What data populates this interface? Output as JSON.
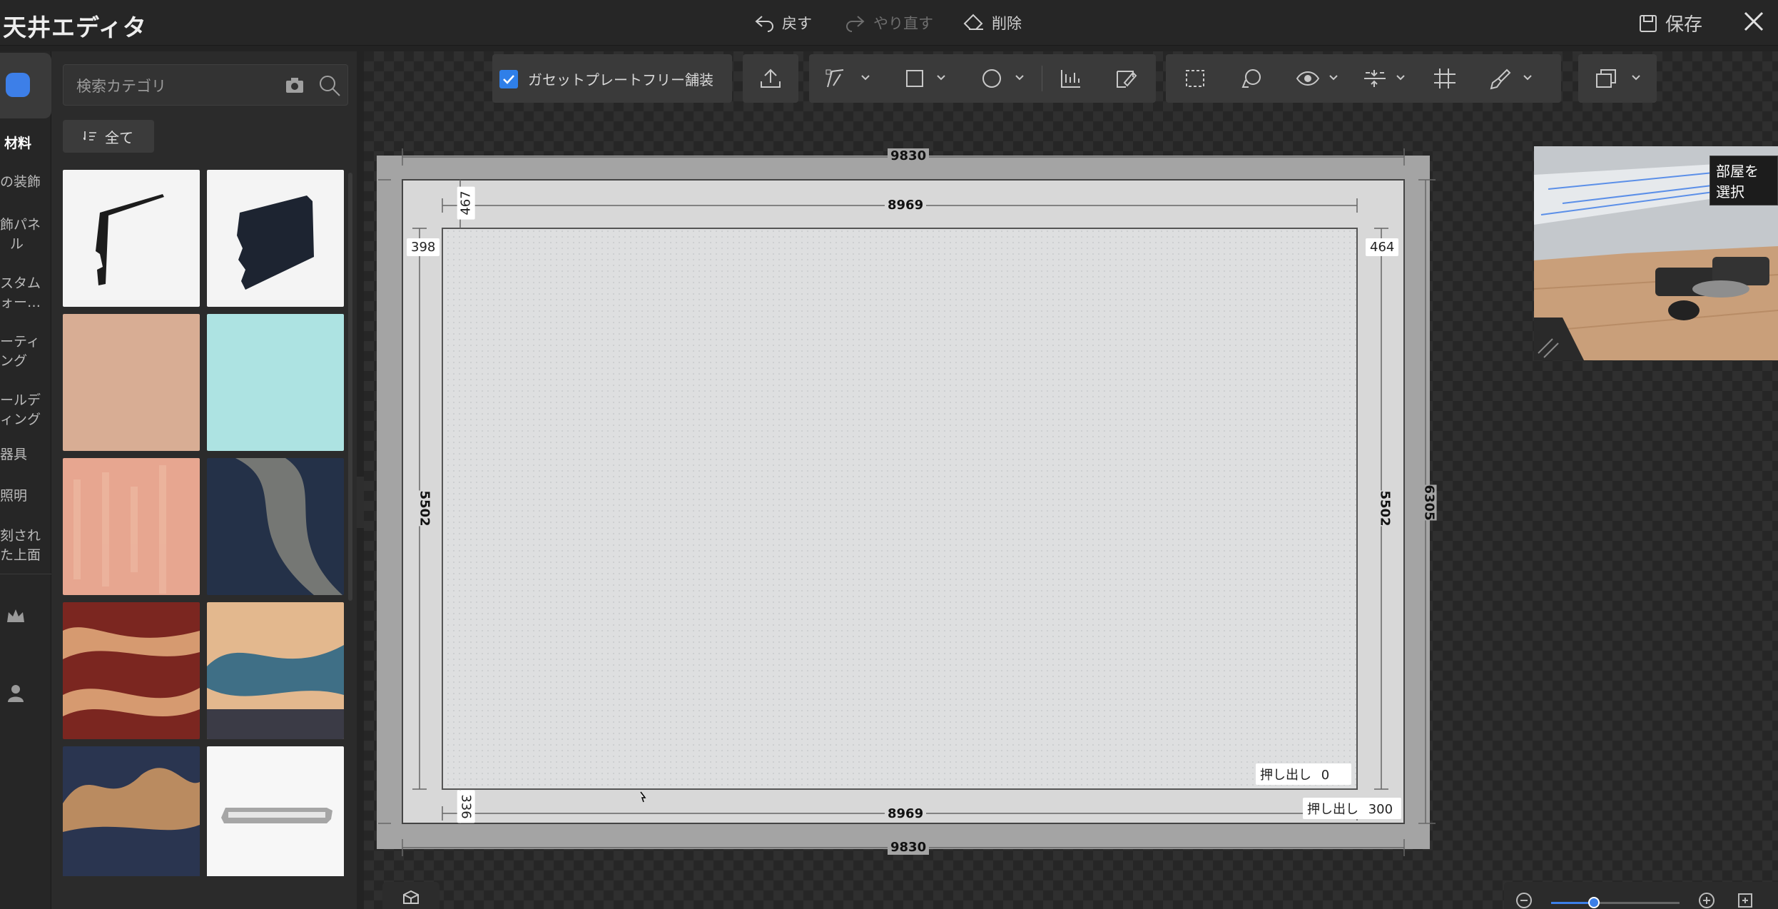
{
  "app": {
    "title": "天井エディタ"
  },
  "topbar": {
    "undo_label": "戻す",
    "redo_label": "やり直す",
    "delete_label": "削除",
    "save_label": "保存"
  },
  "rail": {
    "items": [
      {
        "label": "材料",
        "active": true
      },
      {
        "label": "の装飾"
      },
      {
        "label": "飾パネ"
      },
      {
        "label": "ル"
      },
      {
        "label": "スタム"
      },
      {
        "label": "ォー…"
      },
      {
        "label": "ーティ"
      },
      {
        "label": "ング"
      },
      {
        "label": "ールデ"
      },
      {
        "label": "ィング"
      },
      {
        "label": "器具"
      },
      {
        "label": "照明"
      },
      {
        "label": "刻され"
      },
      {
        "label": "た上面"
      }
    ],
    "icons": [
      "cube-icon",
      "crown-icon",
      "user-icon"
    ]
  },
  "panel": {
    "search_placeholder": "検索カテゴリ",
    "filter_label": "全て",
    "thumbnails": [
      "profile-strip",
      "board-profile",
      "peach-texture",
      "aqua-texture",
      "salmon-texture",
      "navy-marble",
      "red-wave",
      "golden-mountain",
      "navy-mountain",
      "metal-bar"
    ]
  },
  "toolbar": {
    "gusset_label": "ガセットプレートフリー舗装",
    "gusset_checked": true
  },
  "plan": {
    "outer_width_top": "9830",
    "outer_width_bottom": "9830",
    "inner_width_top": "8969",
    "inner_width_bottom": "8969",
    "outer_height_right": "6305",
    "inner_height_left": "5502",
    "inner_height_right": "5502",
    "offset_top": "467",
    "offset_left": "398",
    "offset_right": "464",
    "offset_bottom": "336",
    "extrude_inner_label": "押し出し",
    "extrude_inner_value": "0",
    "extrude_outer_label": "押し出し",
    "extrude_outer_value": "300"
  },
  "preview": {
    "tag": "部屋を選択"
  },
  "zoom": {
    "level_fraction": 0.3
  },
  "colors": {
    "accent": "#3d7fe8",
    "canvas": "#262626",
    "panel": "#2b2b2b"
  }
}
